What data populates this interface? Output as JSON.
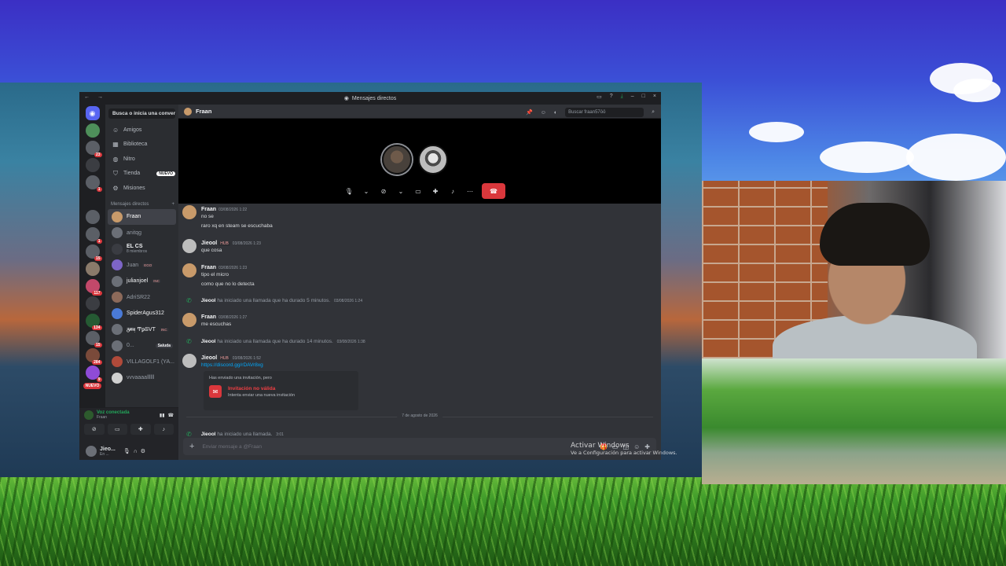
{
  "window": {
    "title": "Mensajes directos"
  },
  "servers": {
    "badges": [
      "23",
      "1",
      "1",
      "15",
      "117",
      "134",
      "15",
      "284",
      "9"
    ],
    "nuevo": "NUEVO"
  },
  "dm_sidebar": {
    "search_placeholder": "Busca o inicia una convers...",
    "nav": [
      {
        "label": "Amigos",
        "icon": "friends-icon"
      },
      {
        "label": "Biblioteca",
        "icon": "library-icon"
      },
      {
        "label": "Nitro",
        "icon": "nitro-icon"
      },
      {
        "label": "Tienda",
        "icon": "shop-icon",
        "pill": "NUEVO"
      },
      {
        "label": "Misiones",
        "icon": "quests-icon"
      }
    ],
    "section_title": "Mensajes directos",
    "add": "+",
    "users": [
      {
        "name": "Fraan",
        "active": true
      },
      {
        "name": "anitqg"
      },
      {
        "name": "EL CS",
        "sub": "8 miembros"
      },
      {
        "name": "Juan",
        "tag": "EGO"
      },
      {
        "name": "julianjoel",
        "tag": "INC"
      },
      {
        "name": "AdriSR22"
      },
      {
        "name": "SpiderAgus312"
      },
      {
        "name": "ᵹ̶ᵯᴉ Ͳϼ̶ЅVΤ",
        "tag": "INC"
      },
      {
        "name": "0...",
        "pill": "Saluda"
      },
      {
        "name": "VILLAGOLF1 (YA..."
      },
      {
        "name": "vvvaaaallllll"
      }
    ]
  },
  "voice_panel": {
    "status": "Voz conectada",
    "channel": "Fraan"
  },
  "userbar": {
    "name": "Jieo...",
    "status": "En ..."
  },
  "channel": {
    "name": "Fraan",
    "search_placeholder": "Buscar fraan57ōō"
  },
  "messages": [
    {
      "author": "Fraan",
      "time": "03/08/2026 1:22",
      "lines": [
        "no se",
        "raro xq en steam se escuchaba"
      ]
    },
    {
      "author": "Jieool",
      "hub": "HUB",
      "time": "03/08/2026 1:23",
      "lines": [
        "que cosa"
      ]
    },
    {
      "author": "Fraan",
      "time": "03/08/2026 1:23",
      "lines": [
        "tipo el micro",
        "como que no lo detecta"
      ]
    },
    {
      "system": true,
      "author": "Jieool",
      "text": "ha iniciado una llamada que ha durado 5 minutos.",
      "time": "03/08/2026 1:24"
    },
    {
      "author": "Fraan",
      "time": "03/08/2026 1:27",
      "lines": [
        "me escuchas"
      ]
    },
    {
      "system": true,
      "author": "Jieool",
      "text": "ha iniciado una llamada que ha durado 14 minutos.",
      "time": "03/08/2026 1:38"
    },
    {
      "author": "Jieool",
      "hub": "HUB",
      "time": "03/08/2026 1:52",
      "lines": [
        "https://discord.gg/rDAVr8xg"
      ]
    },
    {
      "system": true,
      "author": "Jieool",
      "text": "ha iniciado una llamada.",
      "time": "3:01"
    }
  ],
  "invite": {
    "heading": "Has enviado una invitación, pero",
    "title": "Invitación no válida",
    "subtitle": "Intenta enviar una nueva invitación"
  },
  "date_divider": "7 de agosto de 2026",
  "composer": {
    "placeholder": "Enviar mensaje a @Fraan"
  },
  "watermark": {
    "line1": "Activar Windows",
    "line2": "Ve a Configuración para activar Windows."
  }
}
